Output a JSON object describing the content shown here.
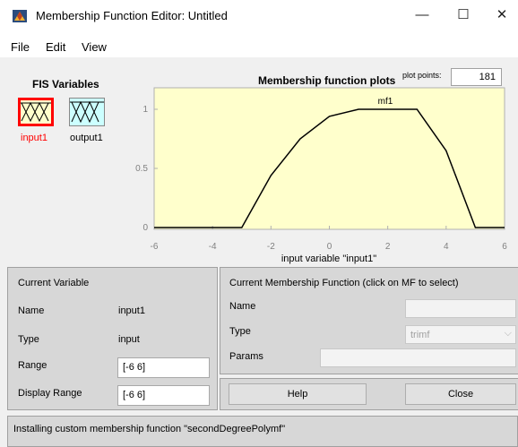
{
  "window": {
    "title": "Membership Function Editor: Untitled",
    "minimize": "—",
    "maximize": "☐",
    "close": "✕"
  },
  "menu": [
    "File",
    "Edit",
    "View"
  ],
  "fis": {
    "title": "FIS Variables",
    "vars": [
      {
        "label": "input1",
        "selected": true
      },
      {
        "label": "output1",
        "selected": false
      }
    ]
  },
  "plot": {
    "title": "Membership function plots",
    "points_label": "plot points:",
    "points_value": "181",
    "mf_label": "mf1",
    "xlabel": "input variable \"input1\"",
    "background": "#ffffcc"
  },
  "chart_data": {
    "type": "line",
    "xlim": [
      -6,
      6
    ],
    "ylim": [
      0,
      1
    ],
    "xticks": [
      "-6",
      "-4",
      "-2",
      "0",
      "2",
      "4",
      "6"
    ],
    "yticks": [
      "0",
      "0.5",
      "1"
    ],
    "series": [
      {
        "name": "mf1",
        "x": [
          -6,
          -3,
          -2,
          -1,
          0,
          1,
          3,
          4,
          5,
          6
        ],
        "y": [
          0,
          0,
          0.44,
          0.75,
          0.94,
          1,
          1,
          0.65,
          0,
          0
        ]
      }
    ],
    "xlabel": "input variable \"input1\"",
    "title": "Membership function plots"
  },
  "current_variable": {
    "heading": "Current Variable",
    "name_label": "Name",
    "name_value": "input1",
    "type_label": "Type",
    "type_value": "input",
    "range_label": "Range",
    "range_value": "[-6 6]",
    "display_range_label": "Display Range",
    "display_range_value": "[-6 6]"
  },
  "current_mf": {
    "heading": "Current Membership Function (click on MF to select)",
    "name_label": "Name",
    "name_value": "",
    "type_label": "Type",
    "type_value": "trimf",
    "params_label": "Params",
    "params_value": ""
  },
  "buttons": {
    "help": "Help",
    "close": "Close"
  },
  "status": "Installing custom membership function \"secondDegreePolymf\""
}
